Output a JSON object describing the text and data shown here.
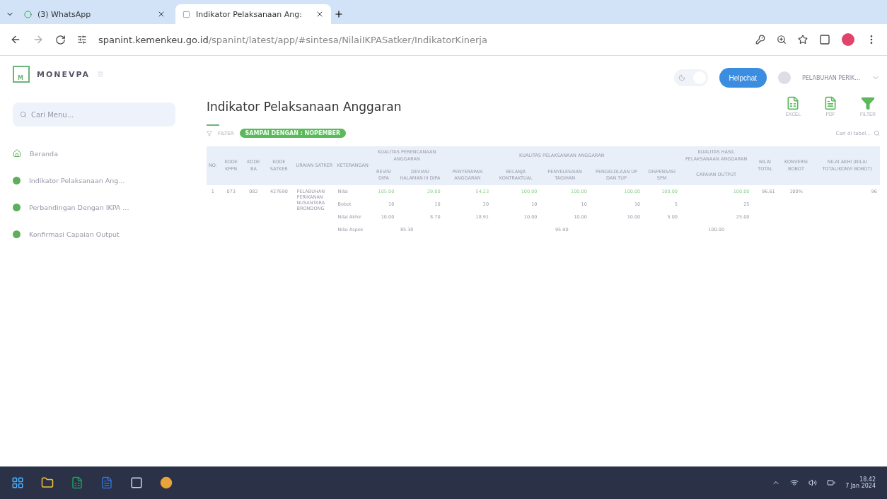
{
  "browser": {
    "tabs": [
      {
        "title": "(3) WhatsApp",
        "kind": "whatsapp",
        "selected": false
      },
      {
        "title": "Indikator Pelaksanaan Ang:",
        "kind": "page",
        "selected": true
      }
    ],
    "url_host": "spanint.kemenkeu.go.id",
    "url_path": "/spanint/latest/app/#sintesa/NilaiIKPASatker/IndikatorKinerja"
  },
  "app": {
    "brand": "MONEVPA",
    "search": {
      "placeholder": "Cari Menu..."
    },
    "nav": [
      {
        "label": "Beranda",
        "kind": "home"
      },
      {
        "label": "Indikator Pelaksanaan Ang...",
        "kind": "dot"
      },
      {
        "label": "Perbandingan Dengan IKPA ...",
        "kind": "dot"
      },
      {
        "label": "Konfirmasi Capaian Output",
        "kind": "dot"
      }
    ],
    "logo_letter": "M",
    "light_mode": true,
    "helpchat": "Helpchat",
    "user": "PELABUHAN PERIK...",
    "title": "Indikator Pelaksanaan Anggaran",
    "actions": [
      {
        "label": "EXCEL",
        "kind": "excel"
      },
      {
        "label": "PDF",
        "kind": "pdf"
      },
      {
        "label": "FILTER",
        "kind": "filter"
      }
    ],
    "filter_label": "FILTER",
    "period_badge": "SAMPAI DENGAN : NOPEMBER",
    "table_search": {
      "placeholder": "Cari di tabel..."
    },
    "table": {
      "columns": [
        {
          "label": "NO."
        },
        {
          "label": "KODE KPPN"
        },
        {
          "label": "KODE BA"
        },
        {
          "label": "KODE SATKER"
        },
        {
          "label": "URAIAN SATKER"
        },
        {
          "label": "KETERANGAN"
        },
        {
          "label": "KUALITAS PERENCANAAN ANGGARAN",
          "children": [
            "REVISI DIPA",
            "DEVIASI HALAMAN III DIPA"
          ]
        },
        {
          "label": "KUALITAS PELAKSANAAN ANGGARAN",
          "children": [
            "PENYERAPAN ANGGARAN",
            "BELANJA KONTRAKTUAL",
            "PENYELESAIAN TAGIHAN",
            "PENGELOLAAN UP DAN TUP",
            "DISPENSASI SPM"
          ]
        },
        {
          "label": "KUALITAS HASIL PELAKSANAAN ANGGARAN",
          "children": [
            "CAPAIAN OUTPUT"
          ]
        },
        {
          "label": "NILAI TOTAL"
        },
        {
          "label": "KONVERSI BOBOT"
        },
        {
          "label": "NILAI AKHI (NILAI TOTAL/KONVI BOBOT)"
        }
      ],
      "rows": [
        {
          "no": "1",
          "kppn": "073",
          "ba": "082",
          "satker": "427690",
          "uraian": "PELABUHAN PERIKANAN NUSANTARA BRONDONG",
          "total": "96.61",
          "konversi": "100%",
          "akhir": "96",
          "details": [
            {
              "label": "Nilai",
              "kind": "score",
              "values": [
                "105.00",
                "29.80",
                "54.23",
                "100.00",
                "100.00",
                "100.00",
                "100.00",
                "100.00"
              ]
            },
            {
              "label": "Bobot",
              "kind": "plain",
              "values": [
                "10",
                "10",
                "20",
                "10",
                "10",
                "10",
                "5",
                "25"
              ]
            },
            {
              "label": "Nilai Akhir",
              "kind": "plain",
              "values": [
                "10.00",
                "8.70",
                "18.91",
                "10.00",
                "10.00",
                "10.00",
                "5.00",
                "25.00"
              ]
            }
          ],
          "aspect": {
            "label": "Nilai Aspek",
            "values": [
              "85.30",
              "95.90",
              "100.00"
            ]
          }
        }
      ]
    }
  },
  "taskbar": {
    "time": "18.42",
    "date": "7 Jan 2024"
  }
}
